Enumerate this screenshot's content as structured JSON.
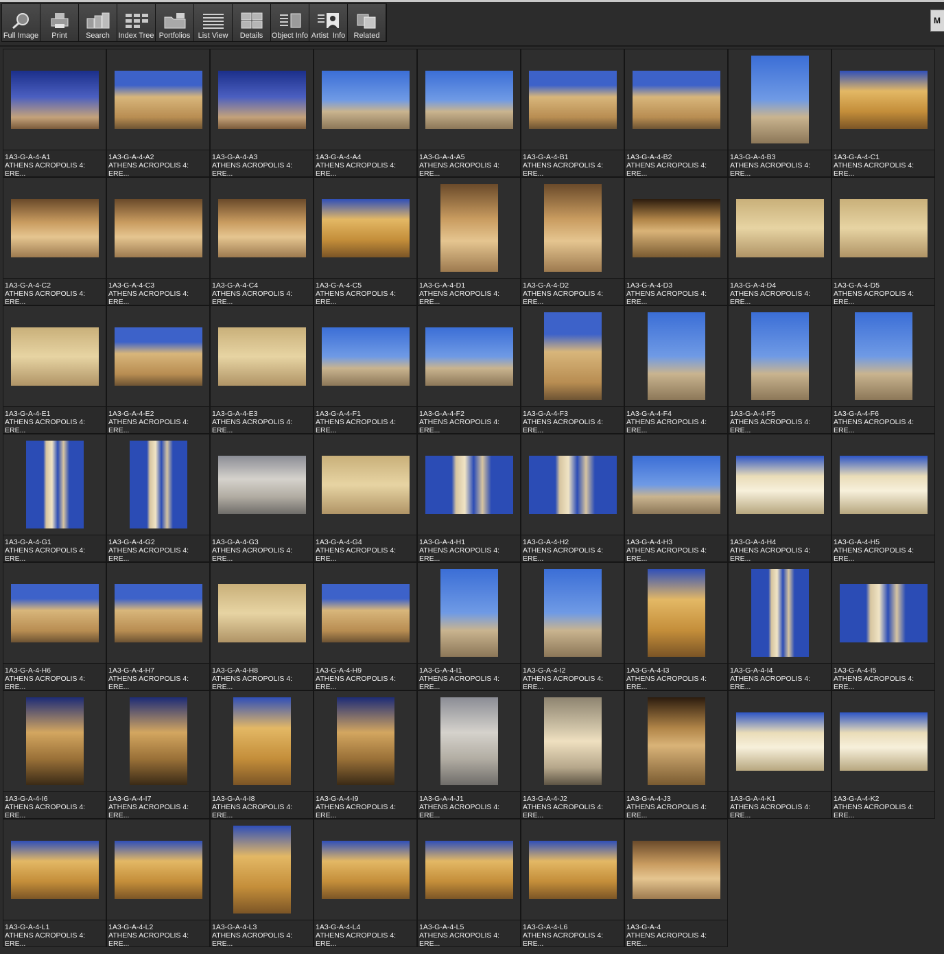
{
  "toolbar": {
    "buttons": [
      {
        "label": "Full Image",
        "icon": "magnifier-icon"
      },
      {
        "label": "Print",
        "icon": "printer-icon"
      },
      {
        "label": "Search",
        "icon": "search-stack-icon"
      },
      {
        "label": "Index Tree",
        "icon": "index-tree-icon"
      },
      {
        "label": "Portfolios",
        "icon": "folder-icon"
      },
      {
        "label": "List View",
        "icon": "list-view-icon"
      },
      {
        "label": "Details",
        "icon": "details-grid-icon"
      },
      {
        "label": "Object Info",
        "icon": "object-info-icon"
      },
      {
        "label": "Artist  Info",
        "icon": "artist-portrait-icon"
      },
      {
        "label": "Related",
        "icon": "related-icon"
      }
    ],
    "right_button": "M"
  },
  "grid": {
    "items": [
      {
        "id": "1A3-G-A-4-A1",
        "title": "ATHENS ACROPOLIS 4:",
        "title_cont": "ERE...",
        "orientation": "land",
        "tone": "p-blue-dusk"
      },
      {
        "id": "1A3-G-A-4-A2",
        "title": "ATHENS ACROPOLIS 4:",
        "title_cont": "ERE...",
        "orientation": "land",
        "tone": "p-stone"
      },
      {
        "id": "1A3-G-A-4-A3",
        "title": "ATHENS ACROPOLIS 4:",
        "title_cont": "ERE...",
        "orientation": "land",
        "tone": "p-blue-dusk"
      },
      {
        "id": "1A3-G-A-4-A4",
        "title": "ATHENS ACROPOLIS 4:",
        "title_cont": "ERE...",
        "orientation": "land",
        "tone": "p-sky"
      },
      {
        "id": "1A3-G-A-4-A5",
        "title": "ATHENS ACROPOLIS 4:",
        "title_cont": "ERE...",
        "orientation": "land",
        "tone": "p-sky"
      },
      {
        "id": "1A3-G-A-4-B1",
        "title": "ATHENS ACROPOLIS 4:",
        "title_cont": "ERE...",
        "orientation": "land",
        "tone": "p-stone"
      },
      {
        "id": "1A3-G-A-4-B2",
        "title": "ATHENS ACROPOLIS 4:",
        "title_cont": "ERE...",
        "orientation": "land",
        "tone": "p-stone"
      },
      {
        "id": "1A3-G-A-4-B3",
        "title": "ATHENS ACROPOLIS 4:",
        "title_cont": "ERE...",
        "orientation": "port",
        "tone": "p-sky"
      },
      {
        "id": "1A3-G-A-4-C1",
        "title": "ATHENS ACROPOLIS 4:",
        "title_cont": "ERE...",
        "orientation": "land",
        "tone": "p-gold"
      },
      {
        "id": "1A3-G-A-4-C2",
        "title": "ATHENS ACROPOLIS 4:",
        "title_cont": "ERE...",
        "orientation": "land",
        "tone": "p-caryatid"
      },
      {
        "id": "1A3-G-A-4-C3",
        "title": "ATHENS ACROPOLIS 4:",
        "title_cont": "ERE...",
        "orientation": "land",
        "tone": "p-caryatid"
      },
      {
        "id": "1A3-G-A-4-C4",
        "title": "ATHENS ACROPOLIS 4:",
        "title_cont": "ERE...",
        "orientation": "land",
        "tone": "p-caryatid"
      },
      {
        "id": "1A3-G-A-4-C5",
        "title": "ATHENS ACROPOLIS 4:",
        "title_cont": "ERE...",
        "orientation": "land",
        "tone": "p-gold"
      },
      {
        "id": "1A3-G-A-4-D1",
        "title": "ATHENS ACROPOLIS 4:",
        "title_cont": "ERE...",
        "orientation": "port",
        "tone": "p-caryatid"
      },
      {
        "id": "1A3-G-A-4-D2",
        "title": "ATHENS ACROPOLIS 4:",
        "title_cont": "ERE...",
        "orientation": "port",
        "tone": "p-caryatid"
      },
      {
        "id": "1A3-G-A-4-D3",
        "title": "ATHENS ACROPOLIS 4:",
        "title_cont": "ERE...",
        "orientation": "land",
        "tone": "p-dark"
      },
      {
        "id": "1A3-G-A-4-D4",
        "title": "ATHENS ACROPOLIS 4:",
        "title_cont": "ERE...",
        "orientation": "land",
        "tone": "p-wall"
      },
      {
        "id": "1A3-G-A-4-D5",
        "title": "ATHENS ACROPOLIS 4:",
        "title_cont": "ERE...",
        "orientation": "land",
        "tone": "p-wall"
      },
      {
        "id": "1A3-G-A-4-E1",
        "title": "ATHENS ACROPOLIS 4:",
        "title_cont": "ERE...",
        "orientation": "land",
        "tone": "p-wall"
      },
      {
        "id": "1A3-G-A-4-E2",
        "title": "ATHENS ACROPOLIS 4:",
        "title_cont": "ERE...",
        "orientation": "land",
        "tone": "p-stone"
      },
      {
        "id": "1A3-G-A-4-E3",
        "title": "ATHENS ACROPOLIS 4:",
        "title_cont": "ERE...",
        "orientation": "land",
        "tone": "p-wall"
      },
      {
        "id": "1A3-G-A-4-F1",
        "title": "ATHENS ACROPOLIS 4:",
        "title_cont": "ERE...",
        "orientation": "land",
        "tone": "p-sky"
      },
      {
        "id": "1A3-G-A-4-F2",
        "title": "ATHENS ACROPOLIS 4:",
        "title_cont": "ERE...",
        "orientation": "land",
        "tone": "p-sky"
      },
      {
        "id": "1A3-G-A-4-F3",
        "title": "ATHENS ACROPOLIS 4:",
        "title_cont": "ERE...",
        "orientation": "port",
        "tone": "p-stone"
      },
      {
        "id": "1A3-G-A-4-F4",
        "title": "ATHENS ACROPOLIS 4:",
        "title_cont": "ERE...",
        "orientation": "port",
        "tone": "p-sky"
      },
      {
        "id": "1A3-G-A-4-F5",
        "title": "ATHENS ACROPOLIS 4:",
        "title_cont": "ERE...",
        "orientation": "port",
        "tone": "p-sky"
      },
      {
        "id": "1A3-G-A-4-F6",
        "title": "ATHENS ACROPOLIS 4:",
        "title_cont": "ERE...",
        "orientation": "port",
        "tone": "p-sky"
      },
      {
        "id": "1A3-G-A-4-G1",
        "title": "ATHENS ACROPOLIS 4:",
        "title_cont": "ERE...",
        "orientation": "port",
        "tone": "p-column"
      },
      {
        "id": "1A3-G-A-4-G2",
        "title": "ATHENS ACROPOLIS 4:",
        "title_cont": "ERE...",
        "orientation": "port",
        "tone": "p-column"
      },
      {
        "id": "1A3-G-A-4-G3",
        "title": "ATHENS ACROPOLIS 4:",
        "title_cont": "ERE...",
        "orientation": "land",
        "tone": "p-marble"
      },
      {
        "id": "1A3-G-A-4-G4",
        "title": "ATHENS ACROPOLIS 4:",
        "title_cont": "ERE...",
        "orientation": "land",
        "tone": "p-wall"
      },
      {
        "id": "1A3-G-A-4-H1",
        "title": "ATHENS ACROPOLIS 4:",
        "title_cont": "ERE...",
        "orientation": "land",
        "tone": "p-column"
      },
      {
        "id": "1A3-G-A-4-H2",
        "title": "ATHENS ACROPOLIS 4:",
        "title_cont": "ERE...",
        "orientation": "land",
        "tone": "p-column"
      },
      {
        "id": "1A3-G-A-4-H3",
        "title": "ATHENS ACROPOLIS 4:",
        "title_cont": "ERE...",
        "orientation": "land",
        "tone": "p-sky"
      },
      {
        "id": "1A3-G-A-4-H4",
        "title": "ATHENS ACROPOLIS 4:",
        "title_cont": "ERE...",
        "orientation": "land",
        "tone": "p-ionic"
      },
      {
        "id": "1A3-G-A-4-H5",
        "title": "ATHENS ACROPOLIS 4:",
        "title_cont": "ERE...",
        "orientation": "land",
        "tone": "p-ionic"
      },
      {
        "id": "1A3-G-A-4-H6",
        "title": "ATHENS ACROPOLIS 4:",
        "title_cont": "ERE...",
        "orientation": "land",
        "tone": "p-stone"
      },
      {
        "id": "1A3-G-A-4-H7",
        "title": "ATHENS ACROPOLIS 4:",
        "title_cont": "ERE...",
        "orientation": "land",
        "tone": "p-stone"
      },
      {
        "id": "1A3-G-A-4-H8",
        "title": "ATHENS ACROPOLIS 4:",
        "title_cont": "ERE...",
        "orientation": "land",
        "tone": "p-wall"
      },
      {
        "id": "1A3-G-A-4-H9",
        "title": "ATHENS ACROPOLIS 4:",
        "title_cont": "ERE...",
        "orientation": "land",
        "tone": "p-stone"
      },
      {
        "id": "1A3-G-A-4-I1",
        "title": "ATHENS ACROPOLIS 4:",
        "title_cont": "ERE...",
        "orientation": "port",
        "tone": "p-sky"
      },
      {
        "id": "1A3-G-A-4-I2",
        "title": "ATHENS ACROPOLIS 4:",
        "title_cont": "ERE...",
        "orientation": "port",
        "tone": "p-sky"
      },
      {
        "id": "1A3-G-A-4-I3",
        "title": "ATHENS ACROPOLIS 4:",
        "title_cont": "ERE...",
        "orientation": "port",
        "tone": "p-gold"
      },
      {
        "id": "1A3-G-A-4-I4",
        "title": "ATHENS ACROPOLIS 4:",
        "title_cont": "ERE...",
        "orientation": "port",
        "tone": "p-column"
      },
      {
        "id": "1A3-G-A-4-I5",
        "title": "ATHENS ACROPOLIS 4:",
        "title_cont": "ERE...",
        "orientation": "land",
        "tone": "p-column"
      },
      {
        "id": "1A3-G-A-4-I6",
        "title": "ATHENS ACROPOLIS 4:",
        "title_cont": "ERE...",
        "orientation": "port",
        "tone": "p-shade"
      },
      {
        "id": "1A3-G-A-4-I7",
        "title": "ATHENS ACROPOLIS 4:",
        "title_cont": "ERE...",
        "orientation": "port",
        "tone": "p-shade"
      },
      {
        "id": "1A3-G-A-4-I8",
        "title": "ATHENS ACROPOLIS 4:",
        "title_cont": "ERE...",
        "orientation": "port",
        "tone": "p-gold"
      },
      {
        "id": "1A3-G-A-4-I9",
        "title": "ATHENS ACROPOLIS 4:",
        "title_cont": "ERE...",
        "orientation": "port",
        "tone": "p-shade"
      },
      {
        "id": "1A3-G-A-4-J1",
        "title": "ATHENS ACROPOLIS 4:",
        "title_cont": "ERE...",
        "orientation": "port",
        "tone": "p-marble"
      },
      {
        "id": "1A3-G-A-4-J2",
        "title": "ATHENS ACROPOLIS 4:",
        "title_cont": "ERE...",
        "orientation": "port",
        "tone": "p-doorway"
      },
      {
        "id": "1A3-G-A-4-J3",
        "title": "ATHENS ACROPOLIS 4:",
        "title_cont": "ERE...",
        "orientation": "port",
        "tone": "p-dark"
      },
      {
        "id": "1A3-G-A-4-K1",
        "title": "ATHENS ACROPOLIS 4:",
        "title_cont": "ERE...",
        "orientation": "land",
        "tone": "p-ionic"
      },
      {
        "id": "1A3-G-A-4-K2",
        "title": "ATHENS ACROPOLIS 4:",
        "title_cont": "ERE...",
        "orientation": "land",
        "tone": "p-ionic"
      },
      {
        "id": "1A3-G-A-4-L1",
        "title": "ATHENS ACROPOLIS 4:",
        "title_cont": "ERE...",
        "orientation": "land",
        "tone": "p-gold"
      },
      {
        "id": "1A3-G-A-4-L2",
        "title": "ATHENS ACROPOLIS 4:",
        "title_cont": "ERE...",
        "orientation": "land",
        "tone": "p-gold"
      },
      {
        "id": "1A3-G-A-4-L3",
        "title": "ATHENS ACROPOLIS 4:",
        "title_cont": "ERE...",
        "orientation": "port",
        "tone": "p-gold"
      },
      {
        "id": "1A3-G-A-4-L4",
        "title": "ATHENS ACROPOLIS 4:",
        "title_cont": "ERE...",
        "orientation": "land",
        "tone": "p-gold"
      },
      {
        "id": "1A3-G-A-4-L5",
        "title": "ATHENS ACROPOLIS 4:",
        "title_cont": "ERE...",
        "orientation": "land",
        "tone": "p-gold"
      },
      {
        "id": "1A3-G-A-4-L6",
        "title": "ATHENS ACROPOLIS 4:",
        "title_cont": "ERE...",
        "orientation": "land",
        "tone": "p-gold"
      },
      {
        "id": "1A3-G-A-4",
        "title": "ATHENS ACROPOLIS 4:",
        "title_cont": "ERE...",
        "orientation": "land",
        "tone": "p-caryatid"
      }
    ]
  }
}
